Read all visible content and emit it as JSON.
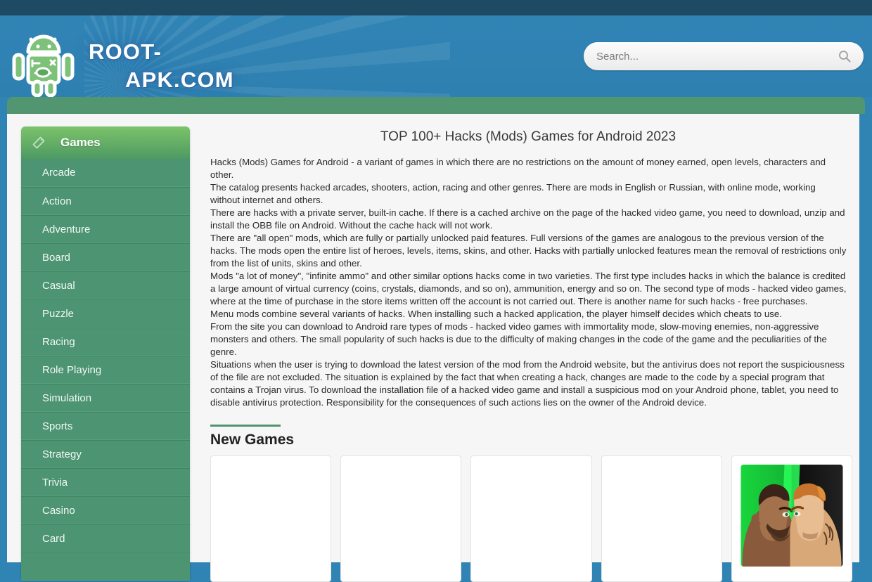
{
  "site": {
    "logo_line1": "ROOT-",
    "logo_line2": "APK.COM",
    "logo_icon": "android-robot-wrench-icon"
  },
  "search": {
    "placeholder": "Search...",
    "value": "",
    "icon": "search-icon"
  },
  "sidebar": {
    "title": "Games",
    "icon": "tag-icon",
    "items": [
      {
        "label": "Arcade"
      },
      {
        "label": "Action"
      },
      {
        "label": "Adventure"
      },
      {
        "label": "Board"
      },
      {
        "label": "Casual"
      },
      {
        "label": "Puzzle"
      },
      {
        "label": "Racing"
      },
      {
        "label": "Role Playing"
      },
      {
        "label": "Simulation"
      },
      {
        "label": "Sports"
      },
      {
        "label": "Strategy"
      },
      {
        "label": "Trivia"
      },
      {
        "label": "Casino"
      },
      {
        "label": "Card"
      },
      {
        "label": ""
      }
    ]
  },
  "main": {
    "title": "TOP 100+ Hacks (Mods) Games for Android 2023",
    "paragraphs": [
      "Hacks (Mods) Games for Android - a variant of games in which there are no restrictions on the amount of money earned, open levels, characters and other.",
      "The catalog presents hacked arcades, shooters, action, racing and other genres. There are mods in English or Russian, with online mode, working without internet and others.",
      "There are hacks with a private server, built-in cache. If there is a cached archive on the page of the hacked video game, you need to download, unzip and install the OBB file on Android. Without the cache hack will not work.",
      "There are \"all open\" mods, which are fully or partially unlocked paid features. Full versions of the games are analogous to the previous version of the hacks. The mods open the entire list of heroes, levels, items, skins, and other. Hacks with partially unlocked features mean the removal of restrictions only from the list of units, skins and other.",
      "Mods \"a lot of money\", \"infinite ammo\" and other similar options hacks come in two varieties. The first type includes hacks in which the balance is credited a large amount of virtual currency (coins, crystals, diamonds, and so on), ammunition, energy and so on. The second type of mods - hacked video games, where at the time of purchase in the store items written off the account is not carried out. There is another name for such hacks - free purchases.",
      "Menu mods combine several variants of hacks. When installing such a hacked application, the player himself decides which cheats to use.",
      "From the site you can download to Android rare types of mods - hacked video games with immortality mode, slow-moving enemies, non-aggressive monsters and others. The small popularity of such hacks is due to the difficulty of making changes in the code of the game and the peculiarities of the genre.",
      "Situations when the user is trying to download the latest version of the mod from the Android website, but the antivirus does not report the suspiciousness of the file are not excluded. The situation is explained by the fact that when creating a hack, changes are made to the code by a special program that contains a Trojan virus. To download the installation file of a hacked video game and install a suspicious mod on your Android phone, tablet, you need to disable antivirus protection. Responsibility for the consequences of such actions lies on the owner of the Android device."
    ],
    "section_title": "New Games",
    "cards": [
      {
        "label": "",
        "thumb": "none"
      },
      {
        "label": "",
        "thumb": "none"
      },
      {
        "label": "",
        "thumb": "none"
      },
      {
        "label": "",
        "thumb": "none"
      },
      {
        "label": "",
        "thumb": "two-fighters-game-icon"
      }
    ]
  },
  "colors": {
    "header_blue": "#2f84b4",
    "topbar_navy": "#1f4a63",
    "green_band": "#519670",
    "sidebar_green": "#4c9472",
    "accent_green": "#4f9471",
    "content_bg": "#f6f6f6"
  }
}
